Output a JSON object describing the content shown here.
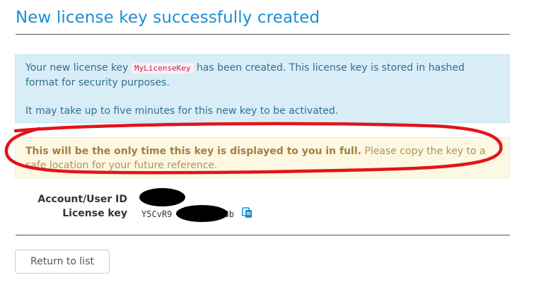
{
  "header": {
    "title": "New license key successfully created"
  },
  "info_alert": {
    "text_before_key": "Your new license key ",
    "key_name": "MyLicenseKey",
    "text_after_key": " has been created. This license key is stored in hashed format for security purposes.",
    "activation_note": "It may take up to five minutes for this new key to be activated."
  },
  "warning_alert": {
    "bold_text": "This will be the only time this key is displayed to you in full.",
    "rest_text": " Please copy the key to a safe location for your future reference."
  },
  "details": {
    "account_label": "Account/User ID",
    "license_label": "License key",
    "license_visible_start": "Y5CvR9",
    "license_visible_end": "o3b"
  },
  "icons": {
    "copy": "copy-icon"
  },
  "actions": {
    "return_label": "Return to list"
  },
  "colors": {
    "title": "#1a8fd6",
    "info_bg": "#d9edf7",
    "info_text": "#31708f",
    "warning_bg": "#fcf8e3",
    "warning_text": "#b39055",
    "code_text": "#c7254e",
    "copy_icon": "#1a8fd6",
    "annotation": "#e3141b",
    "redaction": "#000000"
  }
}
